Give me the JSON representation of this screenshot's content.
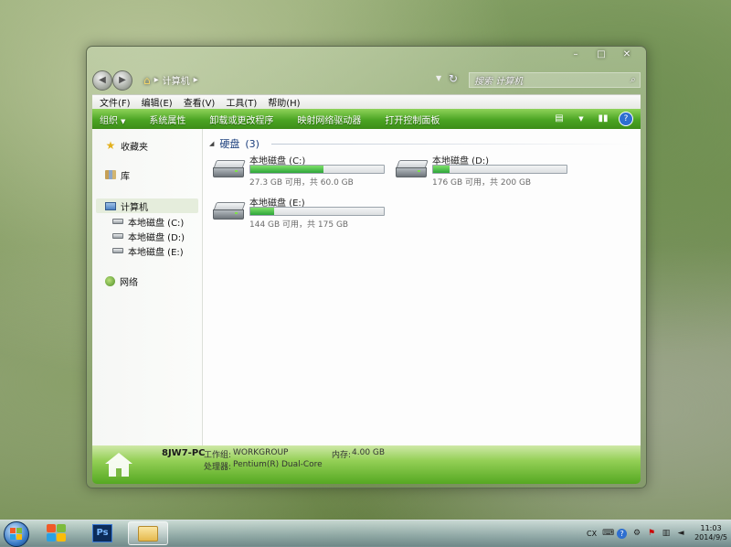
{
  "window": {
    "caption_minimize": "–",
    "caption_maximize": "□",
    "caption_close": "✕"
  },
  "nav": {
    "back": "◀",
    "forward": "▶",
    "home_icon": "⌂",
    "path": "计算机",
    "sep1": "▸",
    "sep2": "▸",
    "dropdown": "▼",
    "refresh": "↻",
    "search_placeholder": "搜索 计算机",
    "search_icon": "⌕"
  },
  "menu": [
    "文件(F)",
    "编辑(E)",
    "查看(V)",
    "工具(T)",
    "帮助(H)"
  ],
  "commands": {
    "organize": "组织",
    "organize_caret": "▼",
    "system_properties": "系统属性",
    "uninstall": "卸载或更改程序",
    "map_drive": "映射网络驱动器",
    "control_panel": "打开控制面板",
    "view_icon": "▤",
    "view_caret": "▼",
    "preview_icon": "▮▮",
    "help": "?"
  },
  "sidebar": {
    "favorites": "收藏夹",
    "libraries": "库",
    "computer": "计算机",
    "drive_c": "本地磁盘 (C:)",
    "drive_d": "本地磁盘 (D:)",
    "drive_e": "本地磁盘 (E:)",
    "network": "网络"
  },
  "content": {
    "group_label": "硬盘",
    "group_count": "(3)",
    "drives": [
      {
        "name": "本地磁盘 (C:)",
        "free_text": "27.3 GB 可用，共 60.0 GB",
        "used_fraction": 0.545
      },
      {
        "name": "本地磁盘 (D:)",
        "free_text": "176 GB 可用，共 200 GB",
        "used_fraction": 0.12
      },
      {
        "name": "本地磁盘 (E:)",
        "free_text": "144 GB 可用，共 175 GB",
        "used_fraction": 0.18
      }
    ]
  },
  "details": {
    "computer_name": "8JW7-PC",
    "workgroup_label": "工作组:",
    "workgroup_value": "WORKGROUP",
    "memory_label": "内存:",
    "memory_value": "4.00 GB",
    "processor_label": "处理器:",
    "processor_value": "Pentium(R) Dual-Core"
  },
  "taskbar": {
    "ps_label": "Ps",
    "lang": "CX",
    "clock_time": "11:03",
    "clock_date": "2014/9/5"
  },
  "colors": {
    "accent_green": "#4ba423",
    "progress_green": "#2da53a",
    "link_blue": "#1b3e7d"
  }
}
